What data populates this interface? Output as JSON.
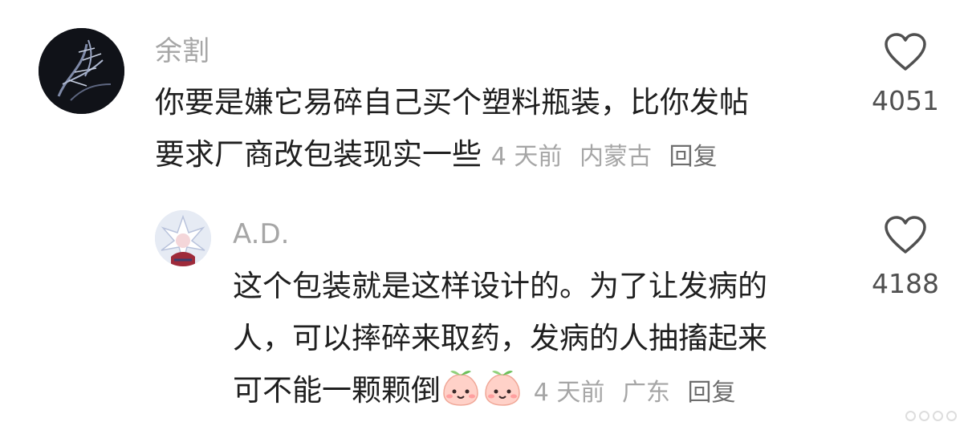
{
  "comments": [
    {
      "username": "余割",
      "avatar": "dark-feather-avatar",
      "text_lines": [
        "你要是嫌它易碎自己买个塑料瓶装，比你发帖",
        "要求厂商改包装现实一些"
      ],
      "time": "4 天前",
      "location": "内蒙古",
      "reply_label": "回复",
      "like_icon": "heart-outline-icon",
      "likes": "4051"
    },
    {
      "username": "A.D.",
      "avatar": "anime-character-avatar",
      "text_lines": [
        "这个包装就是这样设计的。为了让发病的",
        "人，可以摔碎来取药，发病的人抽搐起来",
        "可不能一颗颗倒"
      ],
      "emojis": [
        "peach-smile-emoji",
        "peach-smile-emoji"
      ],
      "time": "4 天前",
      "location": "广东",
      "reply_label": "回复",
      "like_icon": "heart-outline-icon",
      "likes": "4188"
    }
  ],
  "colors": {
    "meta": "#a6a6a6",
    "text": "#1f1f1f",
    "like_count": "#505050"
  }
}
